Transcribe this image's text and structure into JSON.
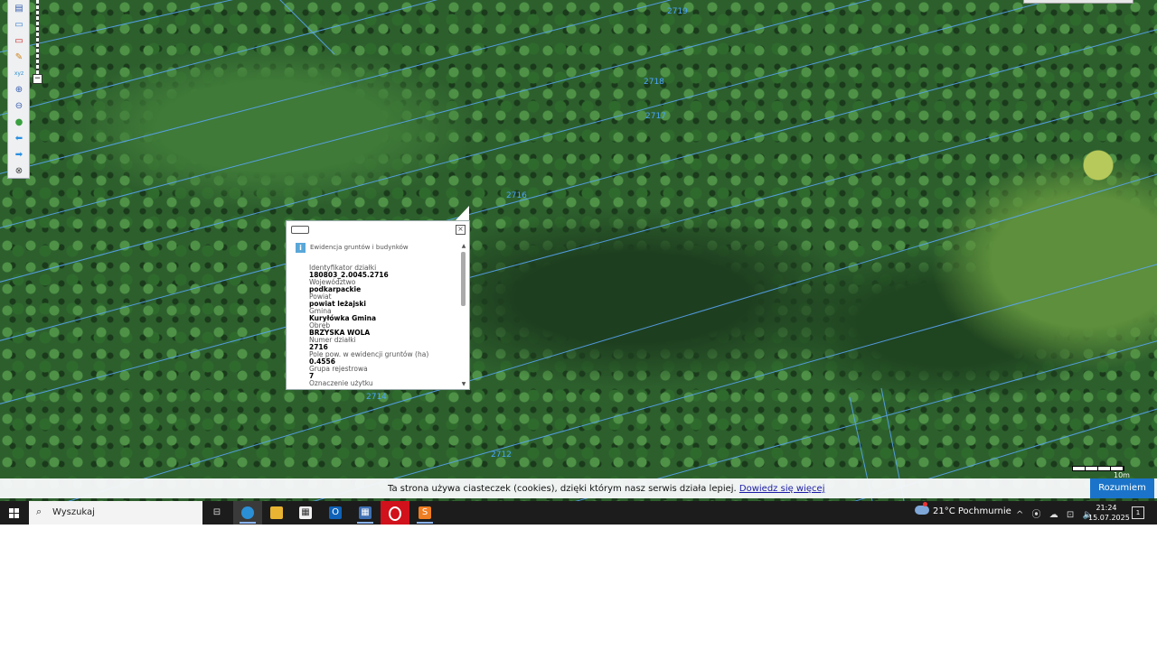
{
  "map": {
    "parcel_labels": [
      "2719",
      "2718",
      "2717",
      "2716",
      "2714",
      "2712"
    ],
    "zoom_handle": "−",
    "scale_label": "10m"
  },
  "toolbar": {
    "tools": [
      {
        "name": "legend-icon",
        "glyph": "▤"
      },
      {
        "name": "select-area-icon",
        "glyph": "▭"
      },
      {
        "name": "clear-selection-icon",
        "glyph": "▭"
      },
      {
        "name": "measure-pencil-icon",
        "glyph": "✎"
      },
      {
        "name": "xyz-coordinates-icon",
        "glyph": "xyz"
      },
      {
        "name": "zoom-in-icon",
        "glyph": "⊕"
      },
      {
        "name": "zoom-out-icon",
        "glyph": "⊖"
      },
      {
        "name": "full-extent-globe-icon",
        "glyph": "●"
      },
      {
        "name": "back-arrow-icon",
        "glyph": "⬅"
      },
      {
        "name": "forward-arrow-icon",
        "glyph": "➡"
      },
      {
        "name": "pan-icon",
        "glyph": "⊗"
      }
    ]
  },
  "popup": {
    "title": "Ewidencja gruntów i budynków",
    "close": "×",
    "info": "i",
    "fields": [
      {
        "label": "Identyfikator działki",
        "value": "180803_2.0045.2716"
      },
      {
        "label": "Województwo",
        "value": "podkarpackie"
      },
      {
        "label": "Powiat",
        "value": "powiat leżajski"
      },
      {
        "label": "Gmina",
        "value": "Kuryłówka Gmina"
      },
      {
        "label": "Obręb",
        "value": "BRZYSKA WOLA"
      },
      {
        "label": "Numer działki",
        "value": "2716"
      },
      {
        "label": "Pole pow. w ewidencji gruntów (ha)",
        "value": "0.4556"
      },
      {
        "label": "Grupa rejestrowa",
        "value": "7"
      },
      {
        "label": "Oznaczenie użytku",
        "value": ""
      }
    ],
    "scroll_up": "▲",
    "scroll_down": "▼"
  },
  "cookie": {
    "text": "Ta strona używa ciasteczek (cookies), dzięki którym nasz serwis działa lepiej.",
    "link": "Dowiedz się więcej",
    "button": "Rozumiem"
  },
  "taskbar": {
    "search_placeholder": "Wyszukaj",
    "weather": "21°C  Pochmurnie",
    "tray": "^ ⦿ ☁ ⊡ 🔈",
    "time": "21:24",
    "date": "15.07.2025",
    "notifications": "1",
    "colors": {
      "accent": "#1b74c9",
      "edge": "#2b8fd6",
      "opera": "#d1111b",
      "calc": "#3e6fb3",
      "outlook": "#0f62b8"
    }
  }
}
